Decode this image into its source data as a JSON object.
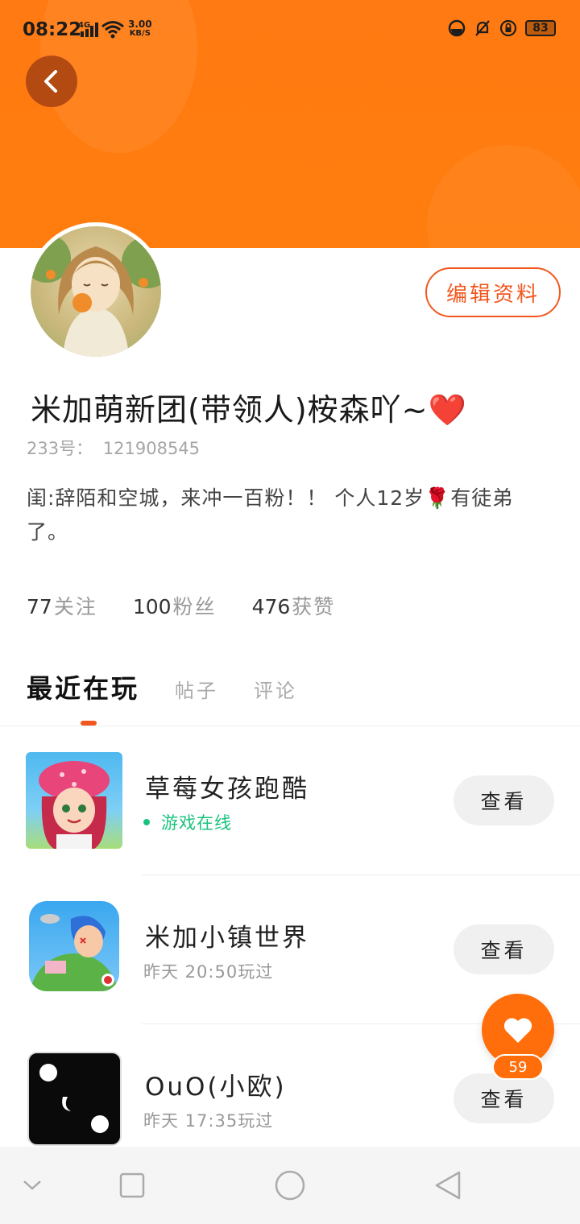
{
  "status_bar": {
    "time": "08:22",
    "network": "4G",
    "speed": "3.00",
    "speed_unit": "KB/S",
    "battery": "83"
  },
  "profile": {
    "username": "米加萌新团(带领人)桉森吖~❤️",
    "uid_label": "233号：",
    "uid": "121908545",
    "bio": "闺:辞陌和空城，来冲一百粉！！ 个人12岁🌹有徒弟了。",
    "edit_button": "编辑资料"
  },
  "stats": {
    "following_count": "77",
    "following_label": "关注",
    "fans_count": "100",
    "fans_label": "粉丝",
    "likes_count": "476",
    "likes_label": "获赞"
  },
  "tabs": [
    {
      "label": "最近在玩",
      "active": true
    },
    {
      "label": "帖子",
      "active": false
    },
    {
      "label": "评论",
      "active": false
    }
  ],
  "games": [
    {
      "title": "草莓女孩跑酷",
      "subtitle": "游戏在线",
      "online": true,
      "button": "查看"
    },
    {
      "title": "米加小镇世界",
      "subtitle": "昨天 20:50玩过",
      "online": false,
      "button": "查看"
    },
    {
      "title": "OuO(小欧)",
      "subtitle": "昨天 17:35玩过",
      "online": false,
      "button": "查看"
    }
  ],
  "like_fab": {
    "count": "59"
  },
  "colors": {
    "header": "#ff7d0e",
    "accent": "#f1571e",
    "online": "#19c37d"
  }
}
